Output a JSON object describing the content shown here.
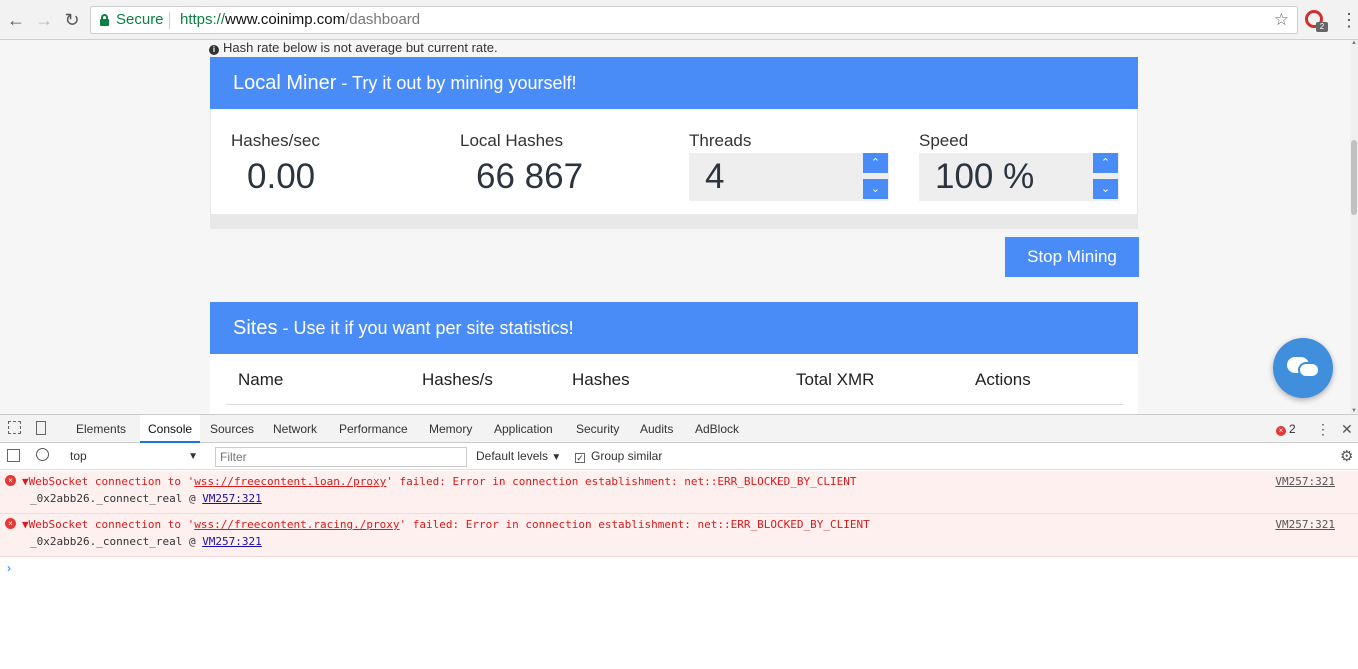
{
  "browser": {
    "secure_label": "Secure",
    "url_scheme": "https://",
    "url_host": "www.coinimp.com",
    "url_path": "/dashboard",
    "ext_badge": "2"
  },
  "page": {
    "note": "Hash rate below is not average but current rate.",
    "local_miner": {
      "title": "Local Miner",
      "subtitle": " - Try it out by mining yourself!",
      "hashes_sec_label": "Hashes/sec",
      "hashes_sec_value": "0.00",
      "local_hashes_label": "Local Hashes",
      "local_hashes_value": "66 867",
      "threads_label": "Threads",
      "threads_value": "4",
      "speed_label": "Speed",
      "speed_value": "100 %"
    },
    "stop_button": "Stop Mining",
    "sites": {
      "title": "Sites",
      "subtitle": " - Use it if you want per site statistics!",
      "columns": [
        "Name",
        "Hashes/s",
        "Hashes",
        "Total XMR",
        "Actions"
      ]
    }
  },
  "devtools": {
    "tabs": [
      "Elements",
      "Console",
      "Sources",
      "Network",
      "Performance",
      "Memory",
      "Application",
      "Security",
      "Audits",
      "AdBlock"
    ],
    "active_tab": "Console",
    "error_count": "2",
    "context": "top",
    "filter_placeholder": "Filter",
    "levels_label": "Default levels",
    "group_similar_label": "Group similar",
    "messages": [
      {
        "prefix": "WebSocket connection to '",
        "url": "wss://freecontent.loan./proxy",
        "suffix": "' failed: Error in connection establishment: net::ERR_BLOCKED_BY_CLIENT",
        "stack_fn": "_0x2abb26._connect_real @ ",
        "stack_link": "VM257:321",
        "source": "VM257:321"
      },
      {
        "prefix": "WebSocket connection to '",
        "url": "wss://freecontent.racing./proxy",
        "suffix": "' failed: Error in connection establishment: net::ERR_BLOCKED_BY_CLIENT",
        "stack_fn": "_0x2abb26._connect_real @ ",
        "stack_link": "VM257:321",
        "source": "VM257:321"
      }
    ]
  }
}
